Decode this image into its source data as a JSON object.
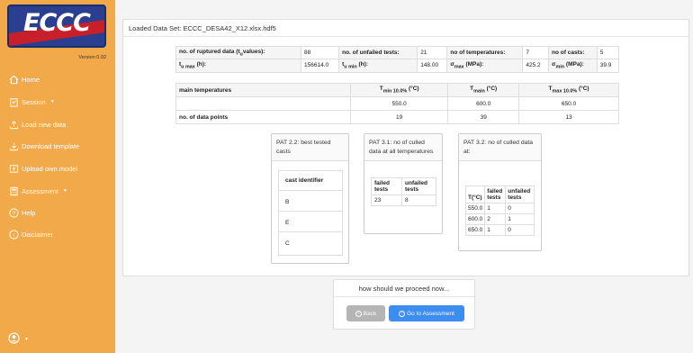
{
  "sidebar": {
    "logo_text": "ECCC",
    "version": "Version 0.92",
    "items": [
      {
        "label": "Home",
        "icon": "home-icon"
      },
      {
        "label": "Session",
        "icon": "clipboard-icon",
        "dropdown": true
      },
      {
        "label": "Load new data",
        "icon": "upload-icon"
      },
      {
        "label": "Download template",
        "icon": "download-icon"
      },
      {
        "label": "Upload own model",
        "icon": "file-upload-icon"
      },
      {
        "label": "Assessment",
        "icon": "calculator-icon",
        "dropdown": true
      },
      {
        "label": "Help",
        "icon": "question-circle-icon"
      },
      {
        "label": "Disclaimer",
        "icon": "info-circle-icon"
      }
    ],
    "accent_color": "#f2a94a"
  },
  "panel": {
    "header": "Loaded Data Set: ECCC_DESA42_X12.xlsx.hdf5"
  },
  "summary": {
    "ruptured_label": "no. of ruptured data (t",
    "ruptured_label_sub": "u",
    "ruptured_label_end": "values):",
    "ruptured_value": "88",
    "unfailed_label": "no. of unfailed tests:",
    "unfailed_value": "21",
    "temps_label": "no of temperatures:",
    "temps_value": "7",
    "casts_label": "no of casts:",
    "casts_value": "5",
    "tumax_label": "t",
    "tumax_sub": "u max",
    "tumax_end": " (h):",
    "tumax_value": "156614.0",
    "tumin_label": "t",
    "tumin_sub": "u min",
    "tumin_end": " (h):",
    "tumin_value": "148.00",
    "smax_label": "σ",
    "smax_sub": "max",
    "smax_end": " (MPa):",
    "smax_value": "425.2",
    "smin_label": "σ",
    "smin_sub": "min",
    "smin_end": " (MPa):",
    "smin_value": "39.9"
  },
  "temps": {
    "row_label": "main temperatures",
    "tmin_label": "T",
    "tmin_sub": "min 10.0%",
    "tmin_unit": " (°C)",
    "tmain_label": "T",
    "tmain_sub": "main",
    "tmain_unit": " (°C)",
    "tmax_label": "T",
    "tmax_sub": "max 10.0%",
    "tmax_unit": " (°C)",
    "values": [
      "550.0",
      "600.0",
      "650.0"
    ],
    "points_label": "no. of data points",
    "points": [
      "19",
      "39",
      "13"
    ]
  },
  "pat22": {
    "title": "PAT 2.2: best tested casts",
    "column_header": "cast identifier",
    "casts": [
      "B",
      "E",
      "C"
    ]
  },
  "pat31": {
    "title": "PAT 3.1: no of culled data at all temperatures",
    "headers": [
      "failed tests",
      "unfailed tests"
    ],
    "values": [
      "23",
      "8"
    ]
  },
  "pat32": {
    "title": "PAT 3.2: no of culled data at:",
    "headers": [
      "T(°C)",
      "failed tests",
      "unfailed tests"
    ],
    "rows": [
      [
        "550.0",
        "1",
        "0"
      ],
      [
        "600.0",
        "2",
        "1"
      ],
      [
        "650.0",
        "1",
        "0"
      ]
    ]
  },
  "proceed": {
    "title": "how should we proceed now...",
    "back_label": "Back",
    "assess_label": "Go to Assessment",
    "back_color": "#b5b5b5",
    "assess_color": "#3d8cf0"
  }
}
